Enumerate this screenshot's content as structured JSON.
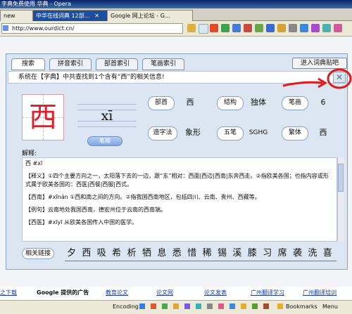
{
  "window": {
    "title": "字典免费使用 华典 - Opera"
  },
  "tabs": [
    {
      "label": "new"
    },
    {
      "label": "中华在线词典 12部…"
    },
    {
      "label": "Google 网上论坛 - G…"
    }
  ],
  "address": {
    "url": "http://www.ourdict.cn/"
  },
  "dict": {
    "tabs": [
      "搜索",
      "拼音索引",
      "部首索引",
      "笔画索引"
    ],
    "post_button": "进入词典贴吧",
    "message": "系统在【字典】中共查找到1个含有“西”的相关信息!",
    "close_symbol": "✕",
    "character": "西",
    "pinyin": "xī",
    "pinyin_button": "笔顺",
    "attrs": {
      "bushou_label": "部首",
      "bushou": "西",
      "jiegou_label": "结构",
      "jiegou": "独体",
      "bihua_label": "笔画",
      "bihua": "6",
      "zaozi_label": "造字法",
      "zaozi": "象形",
      "wubi_label": "五笔",
      "wubi": "SGHG",
      "fanti_label": "繁体",
      "fanti": "西"
    },
    "explain_label": "解释:",
    "explain_paragraphs": [
      "西 #xī",
      "【释义】①四个主要方向之一，太阳落下去的一边，跟“东”相对：西面|西边|西南|东奔西走。②指欧美各国；也指内容或形式属于欧美各国的：西医|西餐|西服|西式。",
      "【西南】#xīnán ①西和南之间的方向。②指我国西南地区，包括四川、云南、贵州、西藏等。",
      "【例句】云南地处我国西南，德宏州位于云南的西南端。",
      "【西医】#xīyī 从欧美各国传入中国的医学。"
    ],
    "related_label": "相关链接",
    "related": [
      "夕",
      "西",
      "吸",
      "希",
      "析",
      "牺",
      "息",
      "悉",
      "惜",
      "稀",
      "锡",
      "溪",
      "膝",
      "习",
      "席",
      "袭",
      "洗",
      "喜"
    ]
  },
  "links": [
    "之下载",
    "Google 提供的广告",
    "教育论文",
    "论文网",
    "论文发表",
    "广州翻译学习",
    "广州翻译培训"
  ],
  "status": {
    "encoding": "Encoding",
    "bookmarks": "Bookmarks",
    "menu": "Menu"
  },
  "colors": {
    "accent_red": "#d8222a",
    "panel_bg": "#dbe6f2",
    "link": "#1a3aa6"
  }
}
